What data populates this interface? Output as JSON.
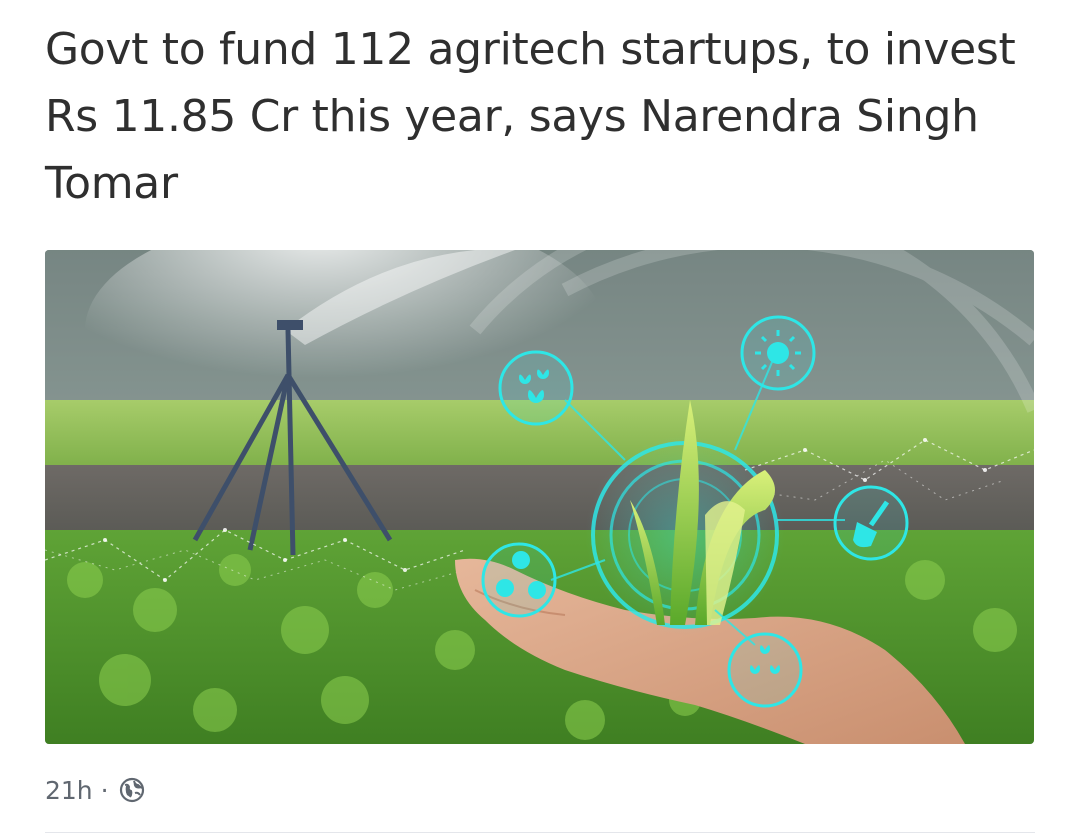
{
  "post": {
    "headline": "Govt to fund 112 agritech startups, to invest Rs 11.85 Cr this year, says Narendra Singh Tomar",
    "timestamp": "21h",
    "separator": "·",
    "privacy_icon": "globe-icon",
    "image_icons": [
      "water-drops-icon",
      "sun-icon",
      "shovel-icon",
      "nutrient-icon",
      "droplets-icon"
    ]
  },
  "colors": {
    "headline": "#2f2f2f",
    "meta": "#606770",
    "accent_cyan": "#2ee6e6",
    "field_green": "#6aa83a"
  }
}
